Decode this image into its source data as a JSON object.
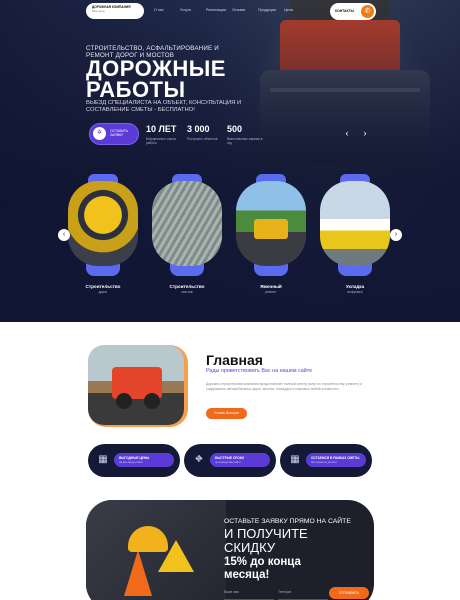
{
  "header": {
    "logo_line1": "ДОРОЖНАЯ КОМПАНИЯ",
    "logo_line2": "Ваш город",
    "nav": [
      "О нас",
      "Услуги",
      "Реализация",
      "Отзывы",
      "Продукция",
      "Цены"
    ],
    "contacts_label": "КОНТАКТЫ",
    "phone_icon": "phone-icon"
  },
  "hero": {
    "subtitle": "СТРОИТЕЛЬСТВО, АСФАЛЬТИРОВАНИЕ И РЕМОНТ ДОРОГ И МОСТОВ",
    "title_line1": "ДОРОЖНЫЕ",
    "title_line2": "РАБОТЫ",
    "description": "ВЫЕЗД СПЕЦИАЛИСТА НА ОБЪЕКТ, КОНСУЛЬТАЦИЯ И СОСТАВЛЕНИЕ СМЕТЫ - БЕСПЛАТНО!",
    "cta_label": "ОСТАВИТЬ ЗАЯВКУ",
    "stats": [
      {
        "value": "10 ЛЕТ",
        "desc": "Безупречного опыта работы"
      },
      {
        "value": "3 000",
        "desc": "Построено объектов"
      },
      {
        "value": "500",
        "desc": "Выполненных заказов в год"
      }
    ],
    "prev_arrow": "‹",
    "next_arrow": "›"
  },
  "cards": [
    {
      "name": "Строительство",
      "sub": "дорог"
    },
    {
      "name": "Строительство",
      "sub": "мостов"
    },
    {
      "name": "Ямочный",
      "sub": "ремонт"
    },
    {
      "name": "Укладка",
      "sub": "асфальта"
    }
  ],
  "slider": {
    "prev": "‹",
    "next": "›"
  },
  "main": {
    "title": "Главная",
    "subtitle": "Рады приветствовать Вас на нашем сайте",
    "text": "Дорожно-строительная компания предоставляет полный спектр услуг по строительству, ремонту и содержанию автомобильных дорог, мостов, площадок и парковок любой сложности.",
    "button": "Узнать больше"
  },
  "features": [
    {
      "icon": "map-icon",
      "title": "ВЫГОДНЫЕ ЦЕНЫ",
      "sub": "на все виды работ"
    },
    {
      "icon": "road-icon",
      "title": "БЫСТРЫЕ СРОКИ",
      "sub": "производства работ"
    },
    {
      "icon": "map-icon",
      "title": "ОСТАЕМСЯ В РАМКАХ СМЕТЫ",
      "sub": "без скрытых доплат"
    }
  ],
  "promo": {
    "line1": "ОСТАВЬТЕ ЗАЯВКУ ПРЯМО НА САЙТЕ",
    "line2": "И ПОЛУЧИТЕ",
    "line3": "СКИДКУ",
    "line4": "15% до конца",
    "line5": "месяца!",
    "input_placeholder": "Ваше имя",
    "input2_placeholder": "Телефон",
    "button": "ОТПРАВИТЬ"
  }
}
